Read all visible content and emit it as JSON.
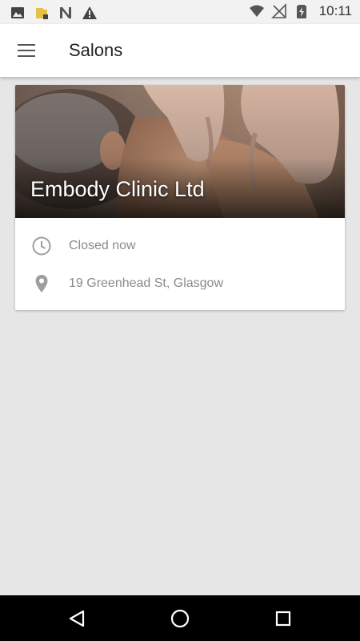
{
  "status_bar": {
    "left_icons": [
      "image-icon",
      "sd-card-icon",
      "n-logo-icon",
      "warning-icon"
    ],
    "right_icons": [
      "wifi-icon",
      "no-signal-icon",
      "battery-charging-icon"
    ],
    "time": "10:11"
  },
  "app_bar": {
    "menu_icon": "hamburger-menu-icon",
    "title": "Salons"
  },
  "salons": [
    {
      "name": "Embody Clinic Ltd",
      "status": "Closed now",
      "status_icon": "clock-icon",
      "address": "19 Greenhead St, Glasgow",
      "address_icon": "location-pin-icon"
    }
  ],
  "nav_bar": {
    "back_icon": "back-triangle-icon",
    "home_icon": "home-circle-icon",
    "recents_icon": "recents-square-icon"
  },
  "colors": {
    "background": "#e6e6e6",
    "app_bar": "#ffffff",
    "nav_bar": "#000000",
    "secondary_text": "#8a8a8a"
  }
}
